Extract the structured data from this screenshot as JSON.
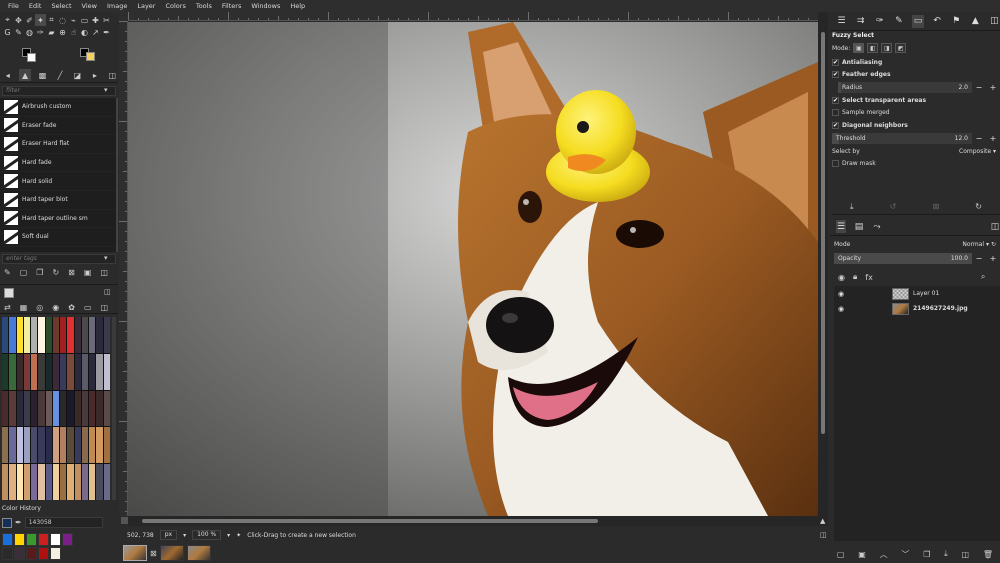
{
  "menubar": {
    "items": [
      "File",
      "Edit",
      "Select",
      "View",
      "Image",
      "Layer",
      "Colors",
      "Tools",
      "Filters",
      "Windows",
      "Help"
    ]
  },
  "brushes": {
    "filter_placeholder": "filter",
    "items": [
      {
        "label": "Airbrush custom"
      },
      {
        "label": "Eraser fade"
      },
      {
        "label": "Eraser Hard flat"
      },
      {
        "label": "Hard fade"
      },
      {
        "label": "Hard solid"
      },
      {
        "label": "Hard taper blot"
      },
      {
        "label": "Hard taper outline sm"
      },
      {
        "label": "Soft dual"
      }
    ],
    "tags_placeholder": "enter tags"
  },
  "color_history": {
    "label": "Color History",
    "hex_value": "143058",
    "swatches": [
      "#1b6fd8",
      "#ffd400",
      "#3b9a2e",
      "#cc2020",
      "#ffffff",
      "#7a1f8a",
      "#2a2a2a",
      "#3a2e3a",
      "#5a1a1a",
      "#b01010",
      "#f4f0e0"
    ]
  },
  "palette": {
    "columns": [
      [
        "#2a4a7a",
        "#1a3a2a",
        "#4a2a2a",
        "#8a7050",
        "#c09060"
      ],
      [
        "#4a7ad8",
        "#3a6a3a",
        "#5a3a3a",
        "#6a6a9a",
        "#e0b080"
      ],
      [
        "#ffe030",
        "#3a2a2a",
        "#2a2a3a",
        "#c0c0e0",
        "#ffe8b0"
      ],
      [
        "#f0f0a0",
        "#7a3a3a",
        "#3a3a4a",
        "#9aa0c0",
        "#d0a070"
      ],
      [
        "#b0b0b0",
        "#c07050",
        "#2a2030",
        "#4a4a6a",
        "#7a6a9a"
      ],
      [
        "#fff4e0",
        "#3a3a3a",
        "#4a3a3a",
        "#3a3a5a",
        "#e0c0a0"
      ],
      [
        "#2a4a2a",
        "#1a2a2a",
        "#6a5a5a",
        "#2a2a4a",
        "#5a5a8a"
      ],
      [
        "#6a3a2a",
        "#3a2a3a",
        "#6a90e0",
        "#d0a080",
        "#f0d0a0"
      ],
      [
        "#a02020",
        "#3a3a5a",
        "#2a2a2a",
        "#b08060",
        "#9a7040"
      ],
      [
        "#e03030",
        "#7a4a3a",
        "#1a1a2a",
        "#5a4a3a",
        "#e0b070"
      ],
      [
        "#3a2a3a",
        "#2a2a3a",
        "#3a2a2a",
        "#3a3a5a",
        "#c09060"
      ],
      [
        "#4a4a4a",
        "#5a5a6a",
        "#4a3a3a",
        "#8a6a4a",
        "#7a6a8a"
      ],
      [
        "#6a6a7a",
        "#2a2a3a",
        "#4a2a2a",
        "#c08a50",
        "#e0c090"
      ],
      [
        "#2a2a3a",
        "#9a9aa0",
        "#3a2a2a",
        "#d09a60",
        "#4a4a5a"
      ],
      [
        "#3a3a4a",
        "#c0c0d0",
        "#5a4a4a",
        "#a07040",
        "#6a6a8a"
      ]
    ]
  },
  "statusbar": {
    "coords": "502, 738",
    "unit": "px",
    "zoom": "100 %",
    "message": "Click-Drag to create a new selection"
  },
  "tool_options": {
    "title": "Fuzzy Select",
    "mode_label": "Mode:",
    "antialiasing": "Antialiasing",
    "feather_edges": "Feather edges",
    "radius_label": "Radius",
    "radius_value": "2.0",
    "select_transparent": "Select transparent areas",
    "sample_merged": "Sample merged",
    "diagonal_neighbors": "Diagonal neighbors",
    "threshold_label": "Threshold",
    "threshold_value": "12.0",
    "threshold_fraction": 0.05,
    "select_by_label": "Select by",
    "select_by_value": "Composite",
    "draw_mask": "Draw mask"
  },
  "layers": {
    "mode_label": "Mode",
    "mode_value": "Normal",
    "opacity_label": "Opacity",
    "opacity_value": "100.0",
    "opacity_fraction": 1.0,
    "items": [
      {
        "name": "Layer 01",
        "type": "transparent"
      },
      {
        "name": "2149627249.jpg",
        "type": "image"
      }
    ]
  },
  "colors": {
    "background": "#2b2b2b",
    "panel_dark": "#1e1e1e",
    "duck_yellow": "#f5dd20",
    "beak_orange": "#f08a20"
  }
}
